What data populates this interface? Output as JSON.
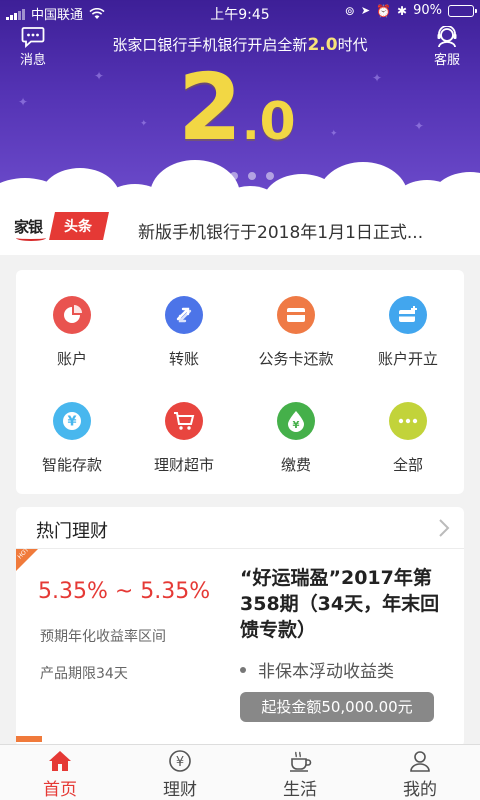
{
  "status_bar": {
    "carrier": "中国联通",
    "time": "上午9:45",
    "battery": "90%",
    "battery_level": 0.9
  },
  "header": {
    "left_button": {
      "label": "消息",
      "icon": "chat-bubble-icon"
    },
    "right_button": {
      "label": "客服",
      "icon": "customer-service-icon"
    },
    "title_prefix": "张家口银行手机银行开启全新",
    "title_version": "2.0",
    "title_suffix": "时代"
  },
  "hero": {
    "big_version_major": "2",
    "big_version_dot": ".",
    "big_version_minor": "0",
    "carousel_count": 5,
    "carousel_active": 2
  },
  "news": {
    "logo_text": "家银",
    "tag": "头条",
    "headline": "新版手机银行于2018年1月1日正式..."
  },
  "services": [
    {
      "label": "账户",
      "icon": "pie-chart-icon",
      "color": "#e9534f"
    },
    {
      "label": "转账",
      "icon": "transfer-arrows-icon",
      "color": "#4c74e8"
    },
    {
      "label": "公务卡还款",
      "icon": "card-icon",
      "color": "#ef7a45"
    },
    {
      "label": "账户开立",
      "icon": "card-add-icon",
      "color": "#42a6ee"
    },
    {
      "label": "智能存款",
      "icon": "yuan-icon",
      "color": "#48b7ee"
    },
    {
      "label": "理财超市",
      "icon": "cart-icon",
      "color": "#e8453f"
    },
    {
      "label": "缴费",
      "icon": "water-drop-yuan-icon",
      "color": "#45b04a"
    },
    {
      "label": "全部",
      "icon": "more-dots-icon",
      "color": "#c2d33a"
    }
  ],
  "hot_finance": {
    "title": "热门理财",
    "tag": "HOT",
    "rate": "5.35% ~ 5.35%",
    "rate_label": "预期年化收益率区间",
    "term": "产品期限34天",
    "product_name": "“好运瑞盈”2017年第358期（34天，年末回馈专款）",
    "product_type": "非保本浮动收益类",
    "min_amount": "起投金额50,000.00元"
  },
  "tabbar": [
    {
      "label": "首页",
      "icon": "home-icon",
      "active": true
    },
    {
      "label": "理财",
      "icon": "yuan-circle-icon",
      "active": false
    },
    {
      "label": "生活",
      "icon": "coffee-cup-icon",
      "active": false
    },
    {
      "label": "我的",
      "icon": "user-icon",
      "active": false
    }
  ],
  "colors": {
    "hero_top": "#3d1f97",
    "hero_bottom": "#6d4ccc",
    "accent": "#e53935",
    "version_gold": "#f2d744"
  }
}
